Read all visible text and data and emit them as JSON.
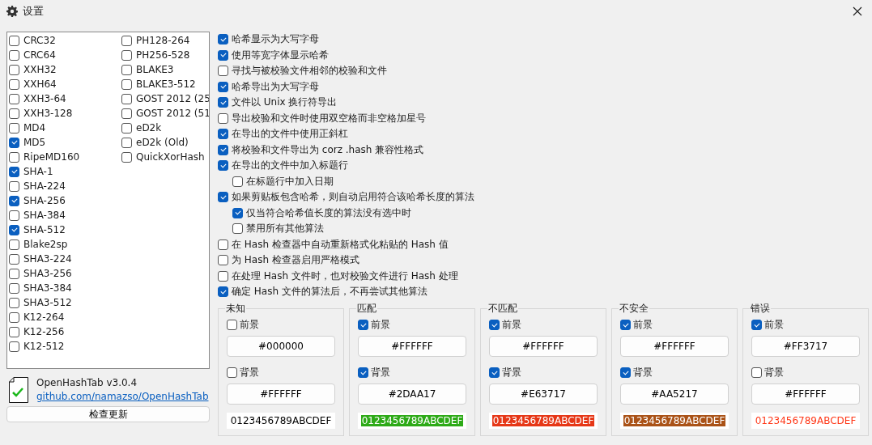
{
  "window": {
    "title": "设置"
  },
  "algorithms": [
    {
      "label": "CRC32",
      "checked": false
    },
    {
      "label": "CRC64",
      "checked": false
    },
    {
      "label": "XXH32",
      "checked": false
    },
    {
      "label": "XXH64",
      "checked": false
    },
    {
      "label": "XXH3-64",
      "checked": false
    },
    {
      "label": "XXH3-128",
      "checked": false
    },
    {
      "label": "MD4",
      "checked": false
    },
    {
      "label": "MD5",
      "checked": true
    },
    {
      "label": "RipeMD160",
      "checked": false
    },
    {
      "label": "SHA-1",
      "checked": true
    },
    {
      "label": "SHA-224",
      "checked": false
    },
    {
      "label": "SHA-256",
      "checked": true
    },
    {
      "label": "SHA-384",
      "checked": false
    },
    {
      "label": "SHA-512",
      "checked": true
    },
    {
      "label": "Blake2sp",
      "checked": false
    },
    {
      "label": "SHA3-224",
      "checked": false
    },
    {
      "label": "SHA3-256",
      "checked": false
    },
    {
      "label": "SHA3-384",
      "checked": false
    },
    {
      "label": "SHA3-512",
      "checked": false
    },
    {
      "label": "K12-264",
      "checked": false
    },
    {
      "label": "K12-256",
      "checked": false
    },
    {
      "label": "K12-512",
      "checked": false
    },
    {
      "label": "PH128-264",
      "checked": false
    },
    {
      "label": "PH256-528",
      "checked": false
    },
    {
      "label": "BLAKE3",
      "checked": false
    },
    {
      "label": "BLAKE3-512",
      "checked": false
    },
    {
      "label": "GOST 2012 (25",
      "checked": false
    },
    {
      "label": "GOST 2012 (51",
      "checked": false
    },
    {
      "label": "eD2k",
      "checked": false
    },
    {
      "label": "eD2k (Old)",
      "checked": false
    },
    {
      "label": "QuickXorHash",
      "checked": false
    }
  ],
  "about": {
    "name": "OpenHashTab v3.0.4",
    "link": "github.com/namazso/OpenHashTab",
    "update_button": "检查更新"
  },
  "options": [
    {
      "label": "哈希显示为大写字母",
      "checked": true
    },
    {
      "label": "使用等宽字体显示哈希",
      "checked": true
    },
    {
      "label": "寻找与被校验文件相邻的校验和文件",
      "checked": false
    },
    {
      "label": "哈希导出为大写字母",
      "checked": true
    },
    {
      "label": "文件以 Unix 换行符导出",
      "checked": true
    },
    {
      "label": "导出校验和文件时使用双空格而非空格加星号",
      "checked": false
    },
    {
      "label": "在导出的文件中使用正斜杠",
      "checked": true
    },
    {
      "label": "将校验和文件导出为 corz .hash 兼容性格式",
      "checked": true
    },
    {
      "label": "在导出的文件中加入标题行",
      "checked": true,
      "children": [
        {
          "label": "在标题行中加入日期",
          "checked": false
        }
      ]
    },
    {
      "label": "如果剪贴板包含哈希，则自动启用符合该哈希长度的算法",
      "checked": true,
      "children": [
        {
          "label": "仅当符合哈希值长度的算法没有选中时",
          "checked": true
        },
        {
          "label": "禁用所有其他算法",
          "checked": false
        }
      ]
    },
    {
      "label": "在 Hash 检查器中自动重新格式化粘贴的 Hash 值",
      "checked": false
    },
    {
      "label": "为 Hash 检查器启用严格模式",
      "checked": false
    },
    {
      "label": "在处理 Hash 文件时，也对校验文件进行 Hash 处理",
      "checked": false
    },
    {
      "label": "确定 Hash 文件的算法后，不再尝试其他算法",
      "checked": true
    }
  ],
  "color_groups": [
    {
      "title": "未知",
      "fg_label": "前景",
      "fg_checked": false,
      "fg": "#000000",
      "bg_label": "背景",
      "bg_checked": false,
      "bg": "#FFFFFF",
      "sample": "0123456789ABCDEF"
    },
    {
      "title": "匹配",
      "fg_label": "前景",
      "fg_checked": true,
      "fg": "#FFFFFF",
      "bg_label": "背景",
      "bg_checked": true,
      "bg": "#2DAA17",
      "sample": "0123456789ABCDEF"
    },
    {
      "title": "不匹配",
      "fg_label": "前景",
      "fg_checked": true,
      "fg": "#FFFFFF",
      "bg_label": "背景",
      "bg_checked": true,
      "bg": "#E63717",
      "sample": "0123456789ABCDEF"
    },
    {
      "title": "不安全",
      "fg_label": "前景",
      "fg_checked": true,
      "fg": "#FFFFFF",
      "bg_label": "背景",
      "bg_checked": true,
      "bg": "#AA5217",
      "sample": "0123456789ABCDEF"
    },
    {
      "title": "错误",
      "fg_label": "前景",
      "fg_checked": true,
      "fg": "#FF3717",
      "bg_label": "背景",
      "bg_checked": false,
      "bg": "#FFFFFF",
      "sample": "0123456789ABCDEF"
    }
  ]
}
